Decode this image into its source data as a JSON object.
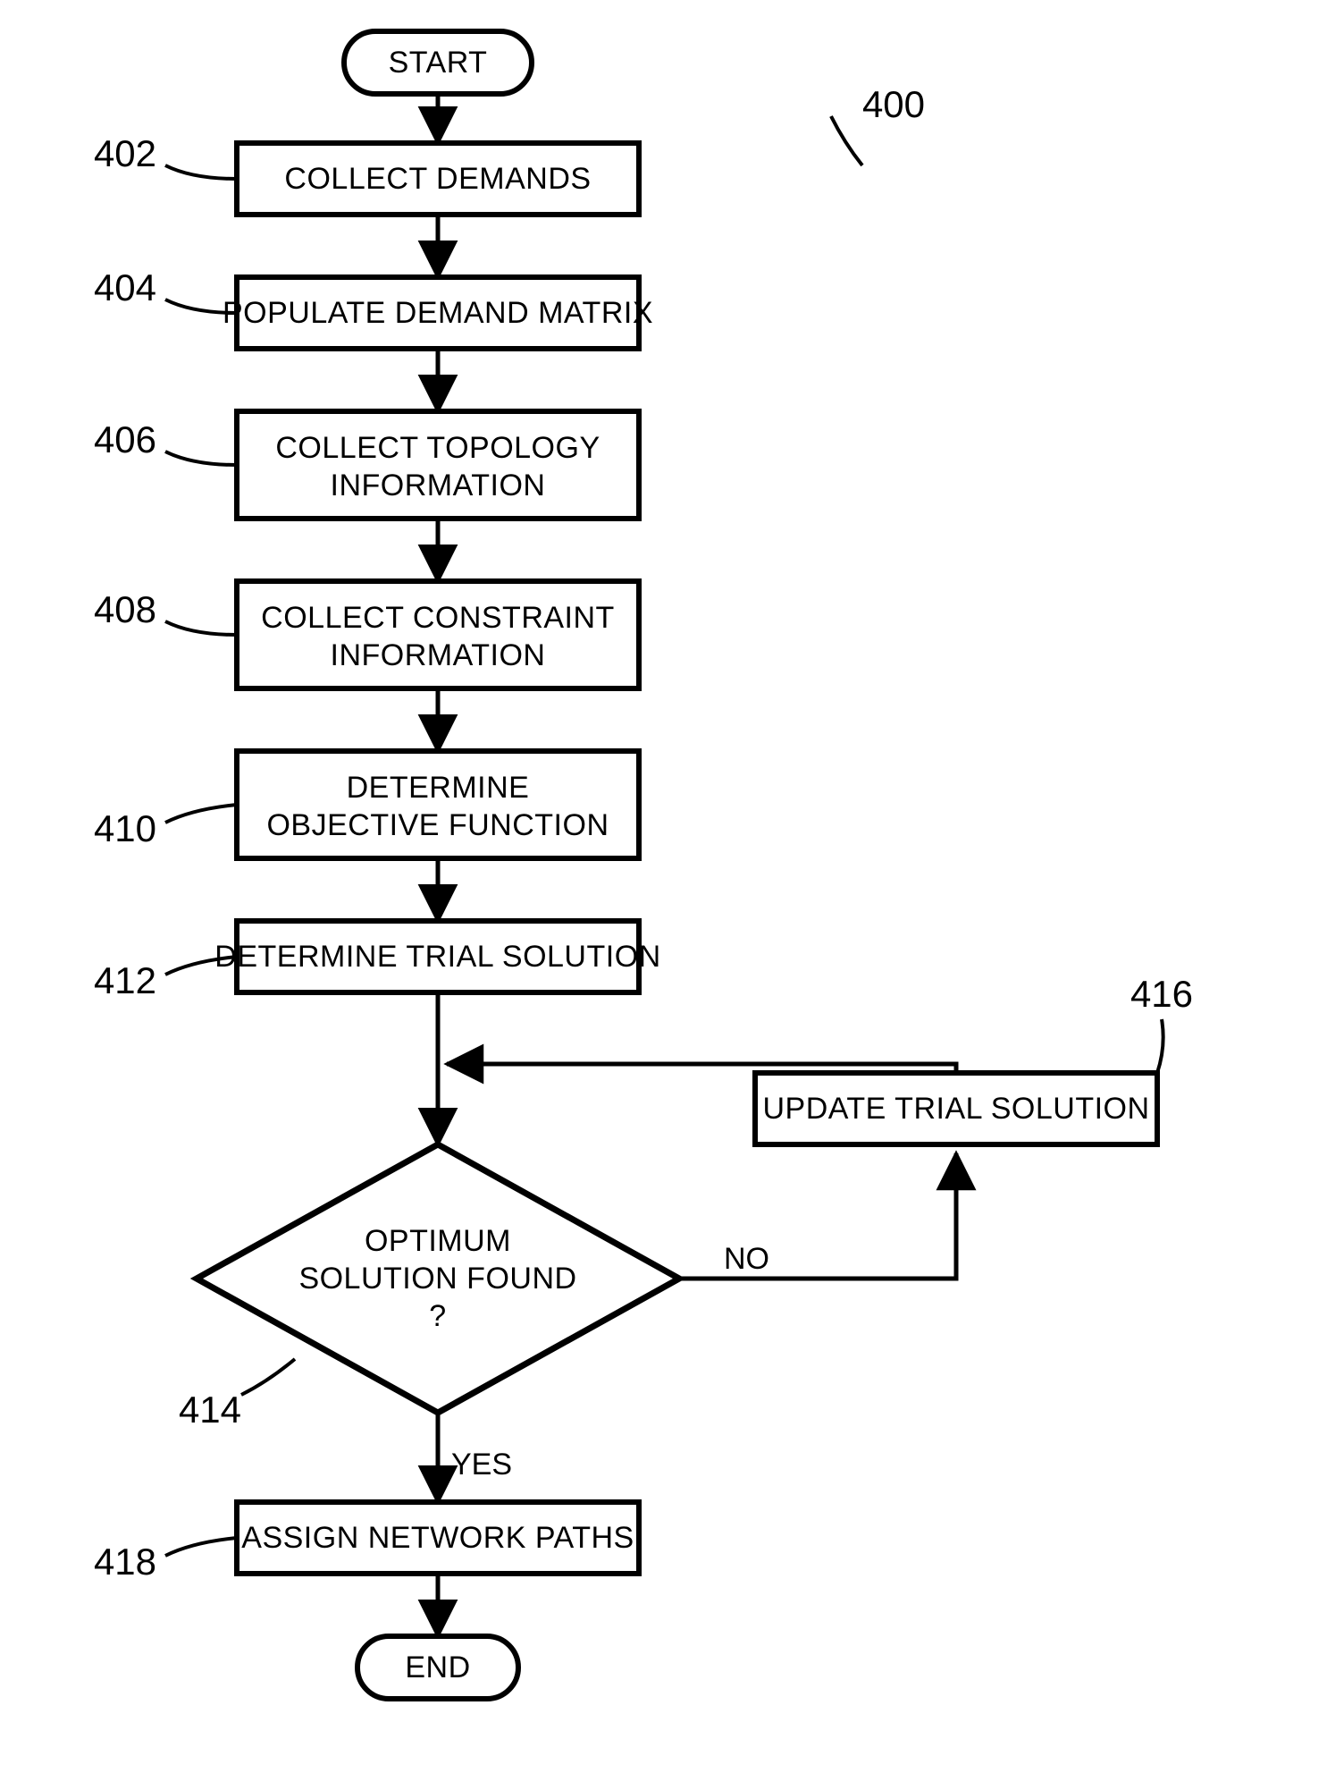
{
  "chart_data": {
    "type": "flowchart",
    "title_ref": "400",
    "nodes": [
      {
        "id": "start",
        "kind": "terminator",
        "label": "START"
      },
      {
        "id": "n402",
        "kind": "process",
        "ref": "402",
        "label": "COLLECT DEMANDS"
      },
      {
        "id": "n404",
        "kind": "process",
        "ref": "404",
        "label": "POPULATE DEMAND MATRIX"
      },
      {
        "id": "n406",
        "kind": "process",
        "ref": "406",
        "label_lines": [
          "COLLECT TOPOLOGY",
          "INFORMATION"
        ]
      },
      {
        "id": "n408",
        "kind": "process",
        "ref": "408",
        "label_lines": [
          "COLLECT CONSTRAINT",
          "INFORMATION"
        ]
      },
      {
        "id": "n410",
        "kind": "process",
        "ref": "410",
        "label_lines": [
          "DETERMINE",
          "OBJECTIVE FUNCTION"
        ]
      },
      {
        "id": "n412",
        "kind": "process",
        "ref": "412",
        "label": "DETERMINE TRIAL SOLUTION"
      },
      {
        "id": "n414",
        "kind": "decision",
        "ref": "414",
        "label_lines": [
          "OPTIMUM",
          "SOLUTION FOUND",
          "?"
        ]
      },
      {
        "id": "n416",
        "kind": "process",
        "ref": "416",
        "label": "UPDATE TRIAL SOLUTION"
      },
      {
        "id": "n418",
        "kind": "process",
        "ref": "418",
        "label": "ASSIGN NETWORK PATHS"
      },
      {
        "id": "end",
        "kind": "terminator",
        "label": "END"
      }
    ],
    "edges": [
      {
        "from": "start",
        "to": "n402"
      },
      {
        "from": "n402",
        "to": "n404"
      },
      {
        "from": "n404",
        "to": "n406"
      },
      {
        "from": "n406",
        "to": "n408"
      },
      {
        "from": "n408",
        "to": "n410"
      },
      {
        "from": "n410",
        "to": "n412"
      },
      {
        "from": "n412",
        "to": "n414"
      },
      {
        "from": "n414",
        "to": "n418",
        "label": "YES"
      },
      {
        "from": "n414",
        "to": "n416",
        "label": "NO"
      },
      {
        "from": "n416",
        "to": "n412_below",
        "note": "feeds back into arrow between n412 and n414"
      },
      {
        "from": "n418",
        "to": "end"
      }
    ]
  },
  "terminators": {
    "start": "START",
    "end": "END"
  },
  "steps": {
    "n402": {
      "ref": "402",
      "line1": "COLLECT DEMANDS"
    },
    "n404": {
      "ref": "404",
      "line1": "POPULATE DEMAND MATRIX"
    },
    "n406": {
      "ref": "406",
      "line1": "COLLECT TOPOLOGY",
      "line2": "INFORMATION"
    },
    "n408": {
      "ref": "408",
      "line1": "COLLECT CONSTRAINT",
      "line2": "INFORMATION"
    },
    "n410": {
      "ref": "410",
      "line1": "DETERMINE",
      "line2": "OBJECTIVE FUNCTION"
    },
    "n412": {
      "ref": "412",
      "line1": "DETERMINE TRIAL SOLUTION"
    },
    "n416": {
      "ref": "416",
      "line1": "UPDATE TRIAL SOLUTION"
    },
    "n418": {
      "ref": "418",
      "line1": "ASSIGN NETWORK PATHS"
    }
  },
  "decision": {
    "n414": {
      "ref": "414",
      "line1": "OPTIMUM",
      "line2": "SOLUTION FOUND",
      "line3": "?"
    }
  },
  "edge_labels": {
    "yes": "YES",
    "no": "NO"
  },
  "figure_ref": "400"
}
